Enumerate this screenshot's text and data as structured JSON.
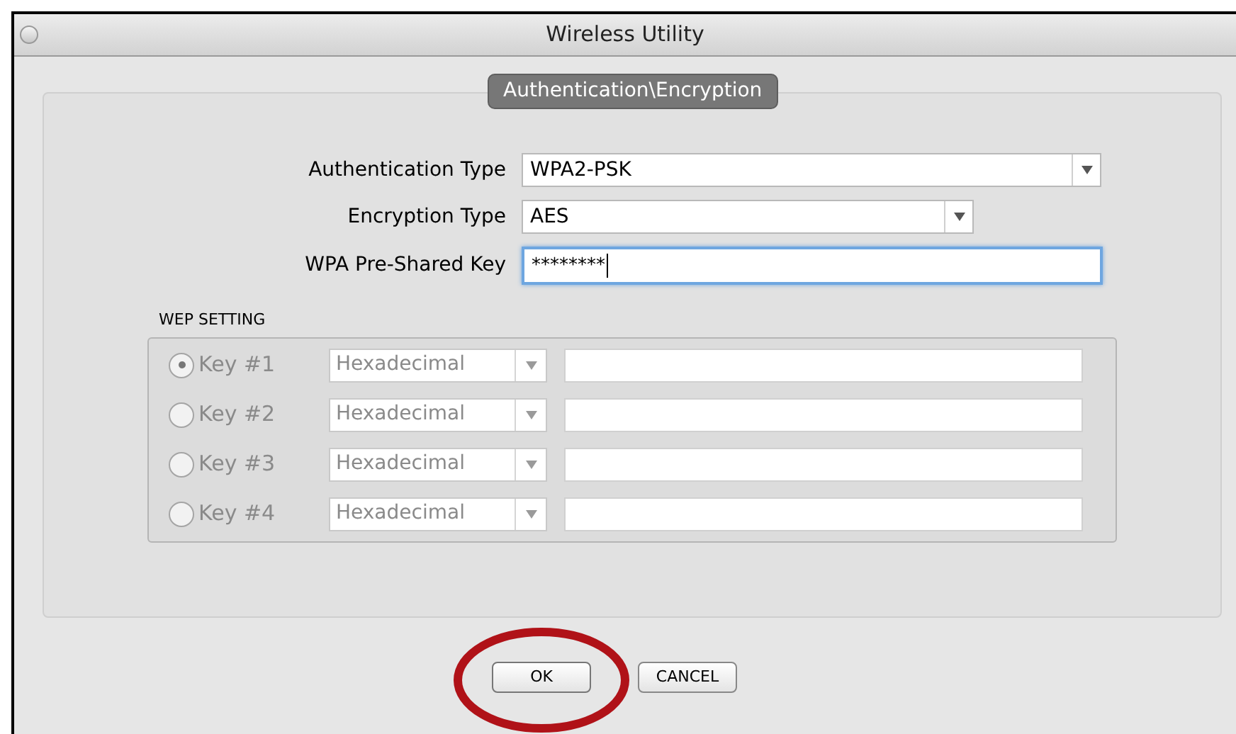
{
  "window": {
    "title": "Wireless Utility"
  },
  "tab": {
    "label": "Authentication\\Encryption"
  },
  "fields": [
    {
      "label": "Authentication Type",
      "value": "WPA2-PSK",
      "kind": "dropdown",
      "focused": false
    },
    {
      "label": "Encryption Type",
      "value": "AES",
      "kind": "short-dropdown",
      "focused": false
    },
    {
      "label": "WPA Pre-Shared Key",
      "value": "********",
      "kind": "password",
      "focused": true
    }
  ],
  "wep_setting": {
    "title": "WEP SETTING",
    "disabled": true,
    "keys": [
      {
        "label": "Key #1",
        "selected": true,
        "format": "Hexadecimal"
      },
      {
        "label": "Key #2",
        "selected": false,
        "format": "Hexadecimal"
      },
      {
        "label": "Key #3",
        "selected": false,
        "format": "Hexadecimal"
      },
      {
        "label": "Key #4",
        "selected": false,
        "format": "Hexadecimal"
      }
    ]
  },
  "buttons": [
    {
      "label": "OK",
      "highlighted": true
    },
    {
      "label": "CANCEL",
      "highlighted": false
    }
  ]
}
